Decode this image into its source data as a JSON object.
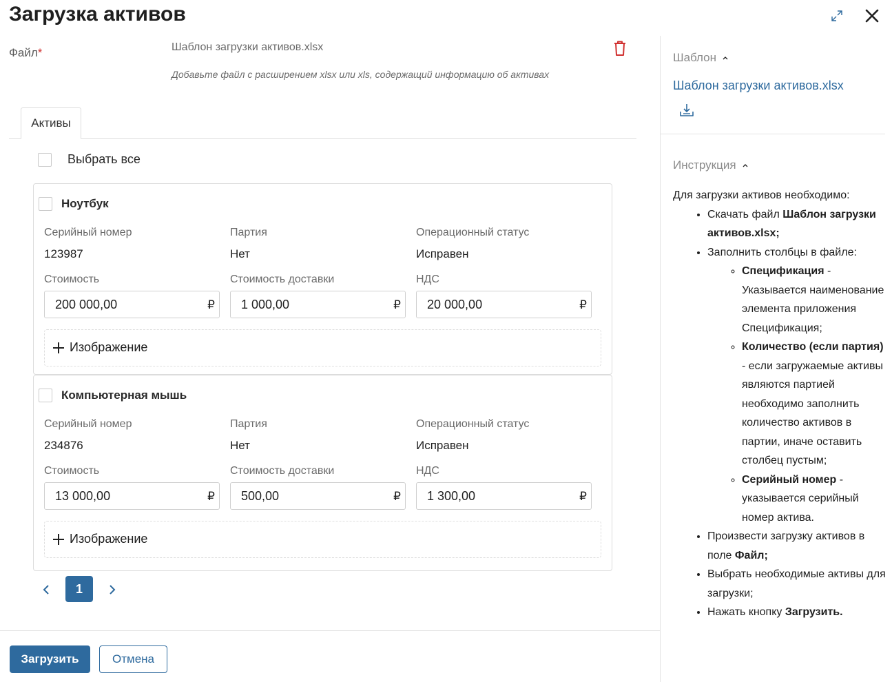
{
  "header": {
    "title": "Загрузка активов",
    "expand_icon": "expand-icon",
    "close_icon": "close-icon"
  },
  "file": {
    "label": "Файл",
    "required_mark": "*",
    "name": "Шаблон загрузки активов.xlsx",
    "hint": "Добавьте файл с расширением xlsx или xls, содержащий информацию об активах"
  },
  "tabs": [
    {
      "label": "Активы"
    }
  ],
  "select_all": "Выбрать все",
  "labels": {
    "serial": "Серийный номер",
    "batch": "Партия",
    "status": "Операционный статус",
    "cost": "Стоимость",
    "delivery": "Стоимость доставки",
    "vat": "НДС",
    "image": "Изображение",
    "currency": "₽"
  },
  "assets": [
    {
      "name": "Ноутбук",
      "serial": "123987",
      "batch": "Нет",
      "status": "Исправен",
      "cost": "200 000,00",
      "delivery": "1 000,00",
      "vat": "20 000,00"
    },
    {
      "name": "Компьютерная мышь",
      "serial": "234876",
      "batch": "Нет",
      "status": "Исправен",
      "cost": "13 000,00",
      "delivery": "500,00",
      "vat": "1 300,00"
    }
  ],
  "pagination": {
    "current": "1"
  },
  "footer": {
    "upload": "Загрузить",
    "cancel": "Отмена"
  },
  "sidebar": {
    "template_title": "Шаблон",
    "template_link": "Шаблон загрузки активов.xlsx",
    "instruction_title": "Инструкция",
    "instruction": {
      "intro": "Для загрузки активов необходимо:",
      "step1_pre": "Скачать файл ",
      "step1_bold": "Шаблон загрузки активов.xlsx;",
      "step2": "Заполнить столбцы в файле:",
      "sub1_bold": "Спецификация",
      "sub1_text": " - Указывается наименование элемента приложения Спецификация;",
      "sub2_bold": "Количество (если партия)",
      "sub2_text": " - если загружаемые активы являются партией необходимо заполнить количество активов в партии, иначе оставить столбец пустым;",
      "sub3_bold": "Серийный номер",
      "sub3_text": " - указывается серийный номер актива.",
      "step3_pre": "Произвести загрузку активов в поле ",
      "step3_bold": "Файл;",
      "step4": "Выбрать необходимые активы для загрузки;",
      "step5_pre": "Нажать кнопку ",
      "step5_bold": "Загрузить."
    }
  },
  "colors": {
    "accent": "#2e6a9e",
    "danger": "#d0302f",
    "muted": "#6a6a6a"
  }
}
